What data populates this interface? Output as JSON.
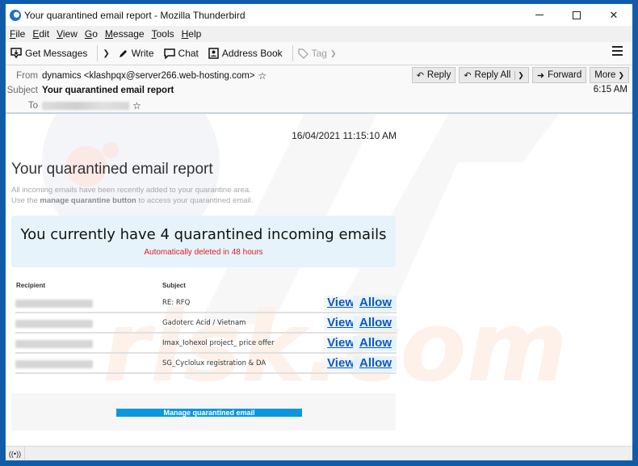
{
  "window": {
    "title": "Your quarantined email report - Mozilla Thunderbird",
    "controls": {
      "minimize": "minimize",
      "maximize": "maximize",
      "close": "✕"
    }
  },
  "menu": [
    {
      "label": "File",
      "accel": "F",
      "rest": "ile"
    },
    {
      "label": "Edit",
      "accel": "E",
      "rest": "dit"
    },
    {
      "label": "View",
      "accel": "V",
      "rest": "iew"
    },
    {
      "label": "Go",
      "accel": "G",
      "rest": "o"
    },
    {
      "label": "Message",
      "accel": "M",
      "rest": "essage"
    },
    {
      "label": "Tools",
      "accel": "T",
      "rest": "ools"
    },
    {
      "label": "Help",
      "accel": "H",
      "rest": "elp"
    }
  ],
  "toolbar": {
    "get_messages": "Get Messages",
    "write": "Write",
    "chat": "Chat",
    "address_book": "Address Book",
    "tag": "Tag"
  },
  "header": {
    "from_label": "From",
    "from_value": "dynamics <klashpqx@server266.web-hosting.com>",
    "subject_label": "Subject",
    "subject_value": "Your quarantined email report",
    "to_label": "To",
    "time": "6:15 AM",
    "actions": {
      "reply": "Reply",
      "reply_all": "Reply All",
      "forward": "Forward",
      "more": "More"
    }
  },
  "message": {
    "date": "16/04/2021 11:15:10 AM",
    "title": "Your quarantined email report",
    "intro_line1": "All incoming emails have been recently added to your quarantine area.",
    "intro_line2_pre": "Use the ",
    "intro_line2_bold": "manage quarantine button",
    "intro_line2_post": " to access your quarantined email.",
    "notice_main": "You currently have 4 quarantined incoming emails",
    "notice_sub": "Automatically deleted in 48 hours",
    "table": {
      "headers": {
        "recipient": "Recipient",
        "subject": "Subject"
      },
      "rows": [
        {
          "subject": "RE: RFQ",
          "view": "View",
          "allow": "Allow"
        },
        {
          "subject": "Gadoterc Acid / Vietnam",
          "view": "View",
          "allow": "Allow"
        },
        {
          "subject": "Imax_Iohexol project_ price offer",
          "view": "View",
          "allow": "Allow"
        },
        {
          "subject": "SG_Cyclolux registration & DA",
          "view": "View",
          "allow": "Allow"
        }
      ]
    },
    "manage_button": "Manage quarantined email"
  },
  "colors": {
    "link": "#0a58ca",
    "alert": "#e01b24",
    "button": "#0b97e0",
    "notice_bg": "#e6f3fa"
  }
}
